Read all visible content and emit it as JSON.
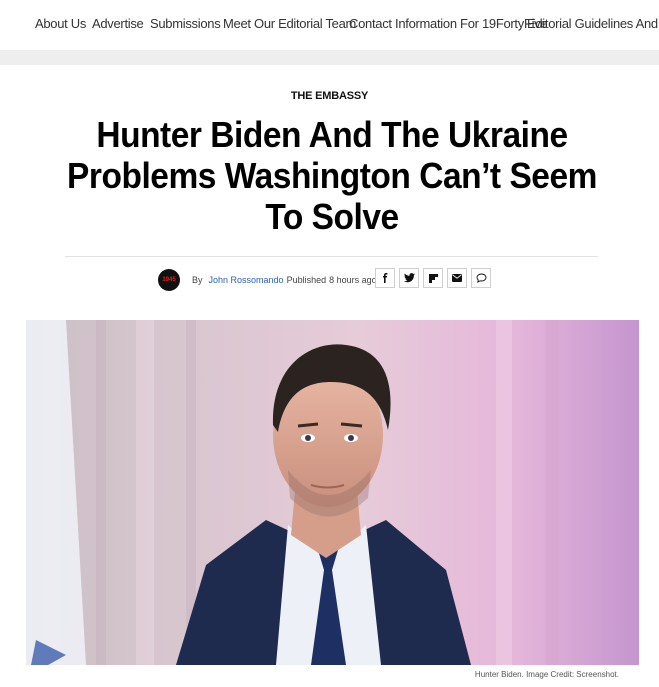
{
  "nav": {
    "items": [
      "About Us",
      "Advertise",
      "Submissions",
      "Meet Our Editorial Team",
      "Contact Information For 19FortyFive",
      "Editorial Guidelines And Publi"
    ]
  },
  "article": {
    "category": "THE EMBASSY",
    "title": "Hunter Biden And The Ukraine Problems Washington Can’t Seem To Solve",
    "byline": {
      "avatar_text": "1945",
      "by_label": "By",
      "author": "John Rossomando",
      "published_label": "Published",
      "time": "8 hours ago"
    },
    "share_icons": [
      "facebook-icon",
      "twitter-icon",
      "flipboard-icon",
      "email-icon",
      "comment-icon"
    ],
    "image_caption": "Hunter Biden. Image Credit: Screenshot."
  },
  "colors": {
    "author_link": "#2a63b5",
    "band": "#eeeeee",
    "avatar_bg": "#111111",
    "avatar_text": "#e02020"
  }
}
